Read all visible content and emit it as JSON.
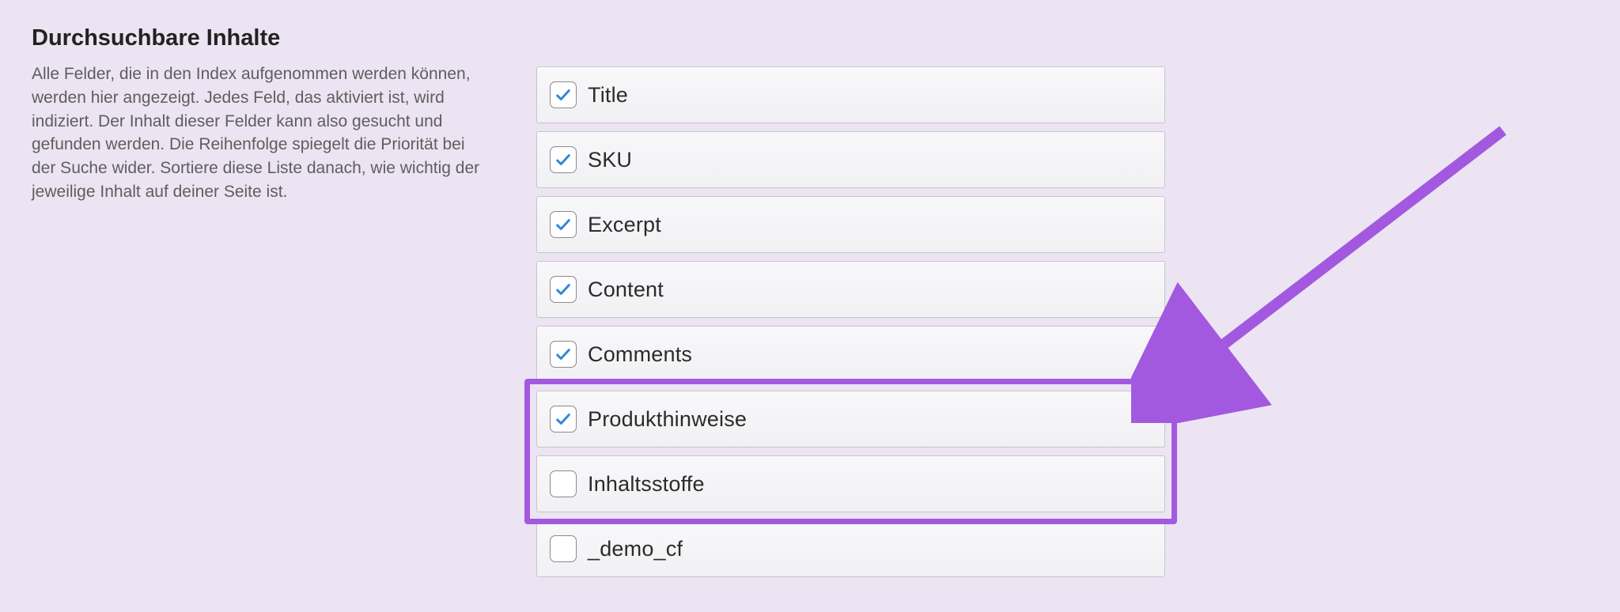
{
  "section": {
    "title": "Durchsuchbare Inhalte",
    "description": "Alle Felder, die in den Index aufgenommen werden können, werden hier angezeigt. Jedes Feld, das aktiviert ist, wird indiziert. Der Inhalt dieser Felder kann also gesucht und gefunden werden. Die Reihenfolge spiegelt die Priorität bei der Suche wider. Sortiere diese Liste danach, wie wichtig der jeweilige Inhalt auf deiner Seite ist."
  },
  "fields": [
    {
      "label": "Title",
      "checked": true
    },
    {
      "label": "SKU",
      "checked": true
    },
    {
      "label": "Excerpt",
      "checked": true
    },
    {
      "label": "Content",
      "checked": true
    },
    {
      "label": "Comments",
      "checked": true
    },
    {
      "label": "Produkthinweise",
      "checked": true
    },
    {
      "label": "Inhaltsstoffe",
      "checked": false
    },
    {
      "label": "_demo_cf",
      "checked": false
    }
  ],
  "annotation": {
    "highlight_start_index": 5,
    "highlight_end_index": 6,
    "arrow_color": "#a259e0"
  }
}
